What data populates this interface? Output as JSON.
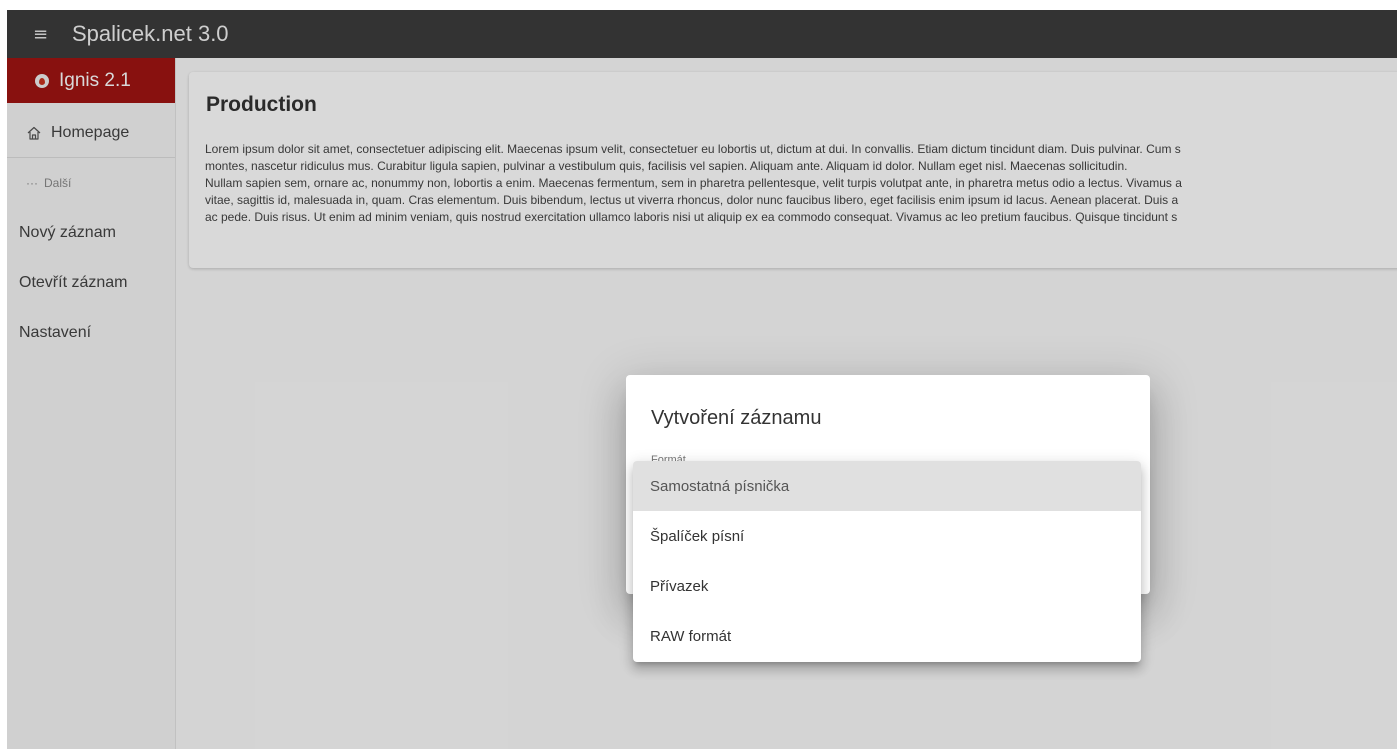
{
  "topbar": {
    "menu_icon": "hamburger-icon",
    "title": "Spalicek.net 3.0"
  },
  "sidebar": {
    "brand": {
      "label": "Ignis 2.1",
      "icon": "flame-icon",
      "color": "#a01512"
    },
    "home": {
      "label": "Homepage",
      "icon": "home-icon"
    },
    "more": {
      "label": "Další",
      "icon": "dots-icon"
    },
    "items": [
      {
        "label": "Nový záznam"
      },
      {
        "label": "Otevřít záznam"
      },
      {
        "label": "Nastavení"
      }
    ]
  },
  "main": {
    "title": "Production",
    "paragraphs": [
      "Lorem ipsum dolor sit amet, consectetuer adipiscing elit. Maecenas ipsum velit, consectetuer eu lobortis ut, dictum at dui. In convallis. Etiam dictum tincidunt diam. Duis pulvinar. Cum s",
      "montes, nascetur ridiculus mus. Curabitur ligula sapien, pulvinar a vestibulum quis, facilisis vel sapien. Aliquam ante. Aliquam id dolor. Nullam eget nisl. Maecenas sollicitudin.",
      "Nullam sapien sem, ornare ac, nonummy non, lobortis a enim. Maecenas fermentum, sem in pharetra pellentesque, velit turpis volutpat ante, in pharetra metus odio a lectus. Vivamus a",
      "vitae, sagittis id, malesuada in, quam. Cras elementum. Duis bibendum, lectus ut viverra rhoncus, dolor nunc faucibus libero, eget facilisis enim ipsum id lacus. Aenean placerat. Duis a",
      "ac pede. Duis risus. Ut enim ad minim veniam, quis nostrud exercitation ullamco laboris nisi ut aliquip ex ea commodo consequat. Vivamus ac leo pretium faucibus. Quisque tincidunt s"
    ]
  },
  "dialog": {
    "title": "Vytvoření záznamu",
    "field_label": "Formát",
    "options": [
      {
        "label": "Samostatná písnička",
        "active": true
      },
      {
        "label": "Špalíček písní"
      },
      {
        "label": "Přívazek"
      },
      {
        "label": "RAW formát"
      }
    ]
  }
}
